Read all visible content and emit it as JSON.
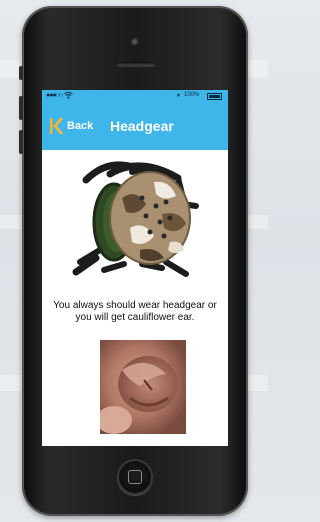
{
  "status_bar": {
    "signal": "●●●○○",
    "wifi_icon": "wifi-icon",
    "bluetooth": "∗",
    "battery_percent": "100%"
  },
  "nav": {
    "back_label": "Back",
    "title": "Headgear"
  },
  "content": {
    "caption": "You always should wear headgear or you will get cauliflower ear."
  },
  "colors": {
    "header": "#3fb6ea",
    "back_icon": "#f4b531",
    "screen_bg": "#ffffff"
  }
}
